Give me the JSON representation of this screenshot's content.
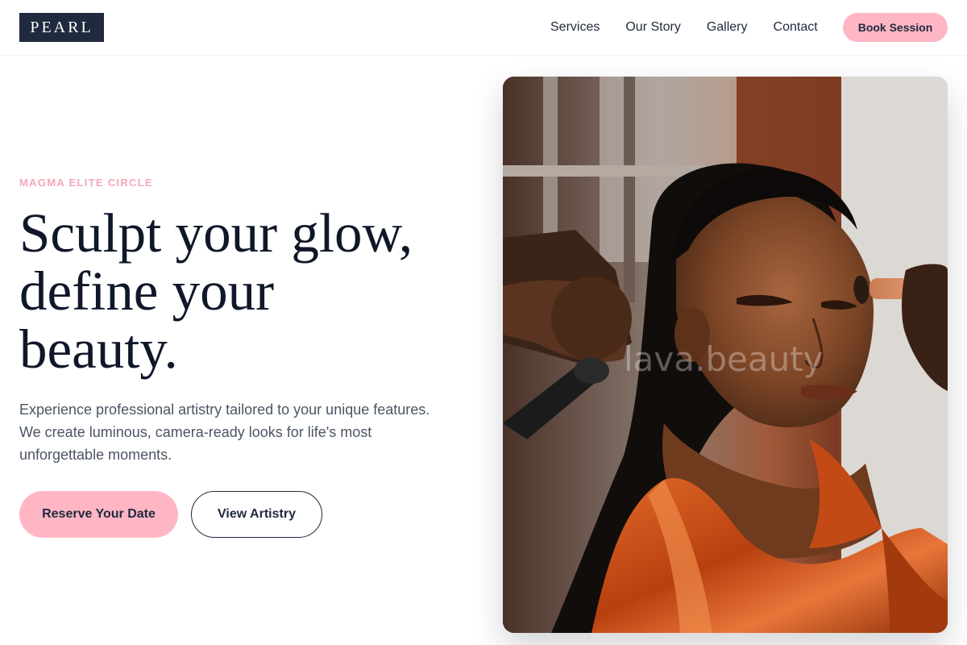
{
  "header": {
    "logo": "PEARL",
    "nav": [
      "Services",
      "Our Story",
      "Gallery",
      "Contact"
    ],
    "cta_label": "Book Session"
  },
  "hero": {
    "eyebrow": "MAGMA ELITE CIRCLE",
    "headline_lines": [
      "Sculpt your glow,",
      "define your",
      "beauty."
    ],
    "description_lines": [
      "Experience professional artistry tailored to your unique features.",
      "We create luminous, camera-ready looks for life's most",
      "unforgettable moments."
    ],
    "primary_button": "Reserve Your Date",
    "secondary_button": "View Artistry"
  },
  "image": {
    "watermark": "lava.beauty"
  },
  "colors": {
    "accent_pink": "#ffb6c4",
    "eyebrow_pink": "#f2a8b7",
    "navy": "#1f2a3e",
    "satin_orange": "#d4541c"
  }
}
